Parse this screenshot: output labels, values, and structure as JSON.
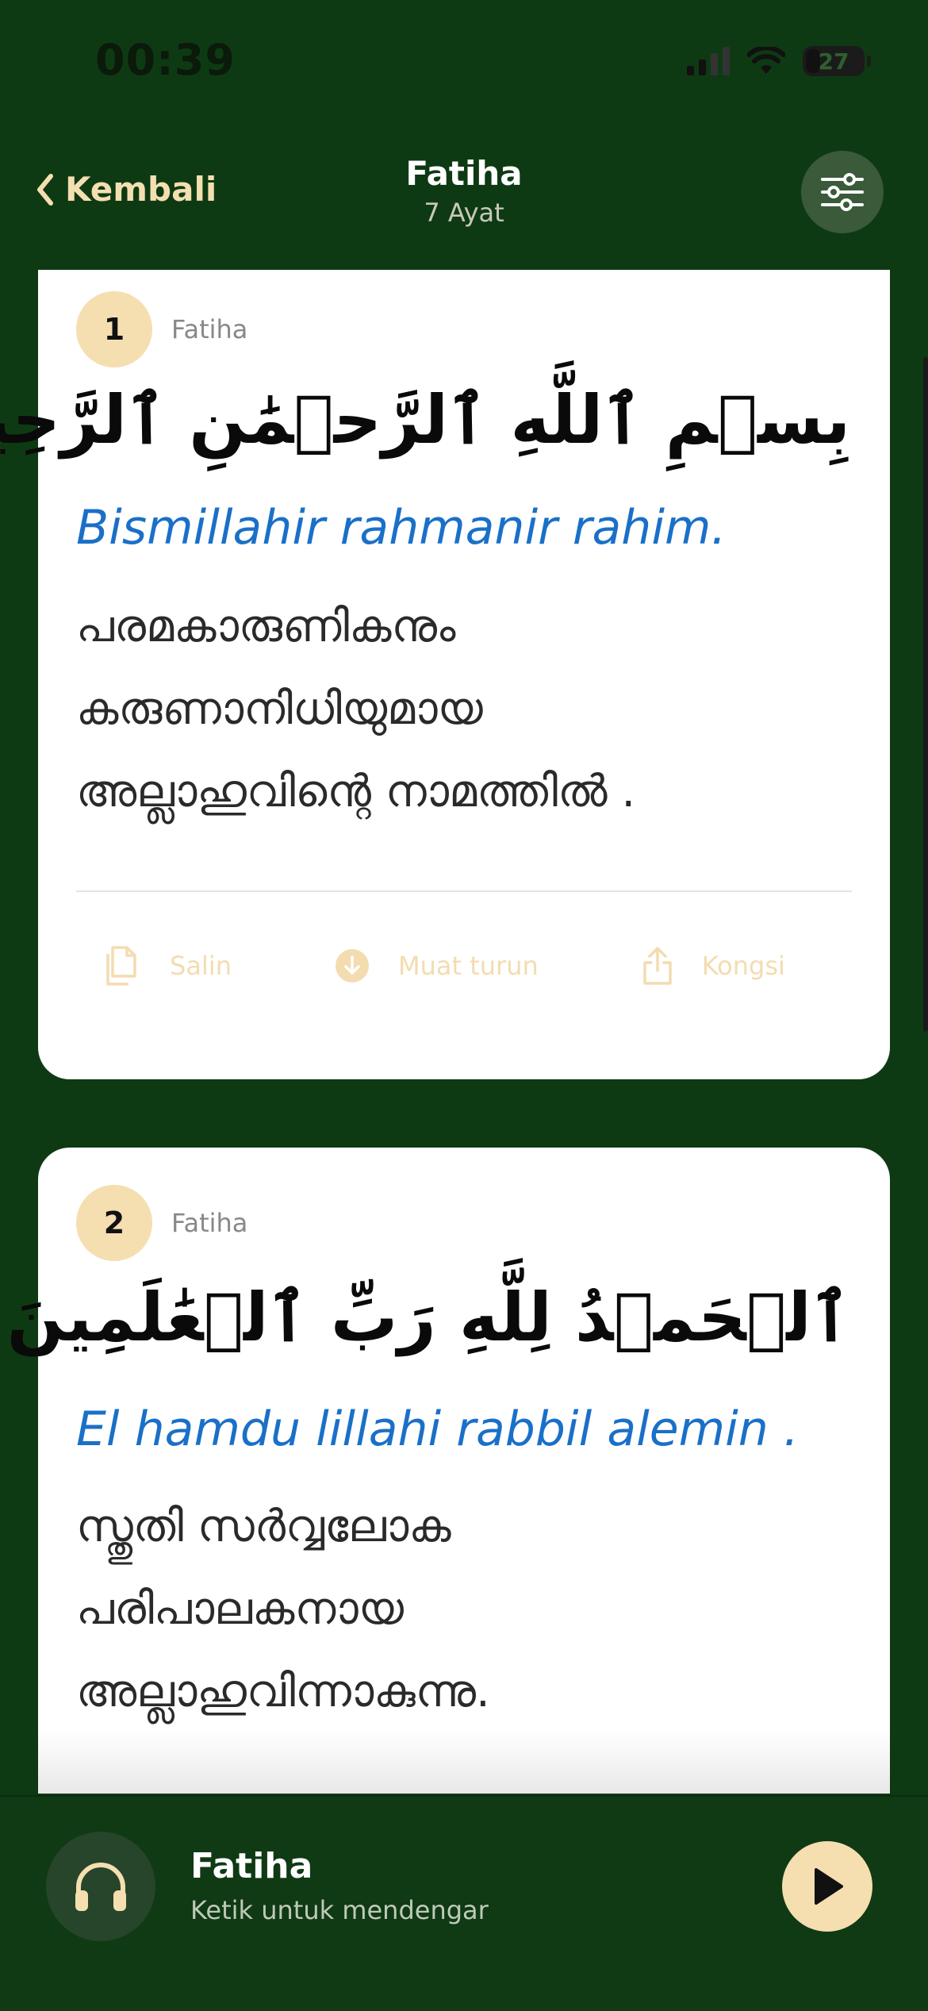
{
  "status": {
    "time": "00:39",
    "battery": "27"
  },
  "header": {
    "back_label": "Kembali",
    "title": "Fatiha",
    "subtitle": "7 Ayat"
  },
  "verses": [
    {
      "number": "1",
      "surah": "Fatiha",
      "arabic": "بِسۡمِ ٱللَّهِ ٱلرَّحۡمَٰنِ ٱلرَّحِيمِ",
      "transliteration": "Bismillahir rahmanir rahim.",
      "translation_lines": [
        "പരമകാരുണികനും",
        "കരുണാനിധിയുമായ",
        "അല്ലാഹുവിന്റെ നാമത്തിൽ ."
      ]
    },
    {
      "number": "2",
      "surah": "Fatiha",
      "arabic": "ٱلۡحَمۡدُ لِلَّهِ رَبِّ ٱلۡعَٰلَمِينَ",
      "transliteration": "El hamdu lillahi rabbil alemin .",
      "translation_lines": [
        "സ്തുതി സർവ്വലോക",
        "പരിപാലകനായ",
        "അല്ലാഹുവിന്നാകുന്നു."
      ]
    }
  ],
  "actions": {
    "copy": "Salin",
    "download": "Muat turun",
    "share": "Kongsi"
  },
  "player": {
    "title": "Fatiha",
    "subtitle": "Ketik untuk mendengar"
  },
  "colors": {
    "background": "#0e3a13",
    "accent": "#f5deb0",
    "transliteration": "#1a70c8"
  }
}
